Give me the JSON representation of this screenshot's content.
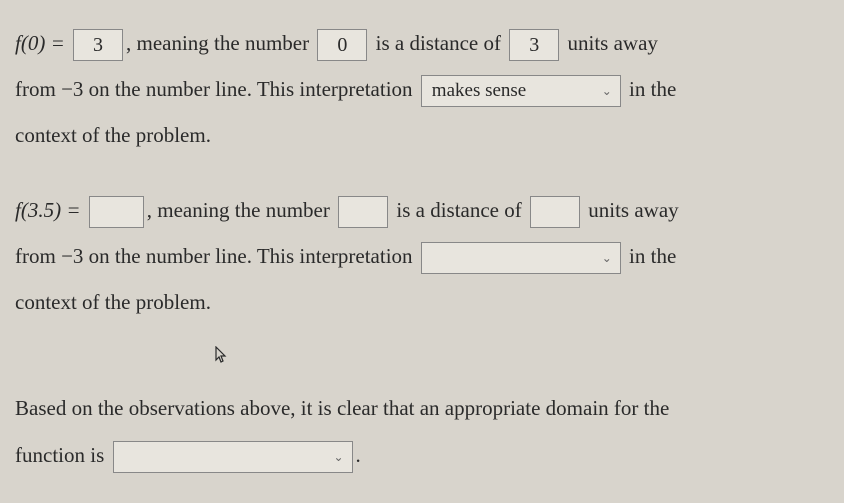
{
  "p1": {
    "func_label": "f(0) =",
    "val1": "3",
    "text1": ", meaning the number",
    "val2": "0",
    "text2": "is a distance of",
    "val3": "3",
    "text3": "units away",
    "text4": "from",
    "neg3": "−3",
    "text5": "on the number line. This interpretation",
    "select1": "makes sense",
    "text6": "in the",
    "text7": "context of the problem."
  },
  "p2": {
    "func_label": "f(3.5) =",
    "val1": "",
    "text1": ", meaning the number",
    "val2": "",
    "text2": "is a distance of",
    "val3": "",
    "text3": "units away",
    "text4": "from",
    "neg3": "−3",
    "text5": "on the number line. This interpretation",
    "select1": "",
    "text6": "in the",
    "text7": "context of the problem."
  },
  "p3": {
    "text1": "Based on the observations above, it is clear that an appropriate domain for the",
    "text2": "function is",
    "select1": "",
    "text3": "."
  }
}
